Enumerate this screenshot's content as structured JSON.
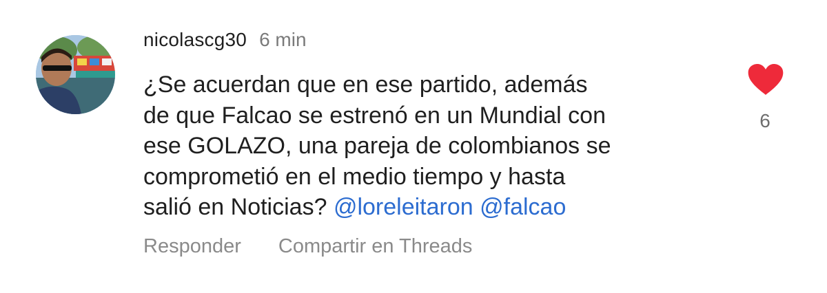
{
  "comment": {
    "username": "nicolascg30",
    "timestamp": "6 min",
    "text_parts": [
      "¿Se acuerdan que en ese partido, además",
      "de que Falcao se estrenó en un Mundial con",
      "ese GOLAZO, una pareja de colombianos se",
      "comprometió en el medio tiempo y hasta",
      "salió en Noticias?"
    ],
    "mentions": [
      "@loreleitaron",
      "@falcao"
    ],
    "like_count": "6",
    "liked": true,
    "actions": {
      "reply": "Responder",
      "share_threads": "Compartir en Threads"
    }
  },
  "colors": {
    "like_heart": "#ee2a3a",
    "mention": "#2c6cd0",
    "secondary_text": "#8a8a8a"
  },
  "icons": {
    "like": "heart-filled-icon"
  }
}
